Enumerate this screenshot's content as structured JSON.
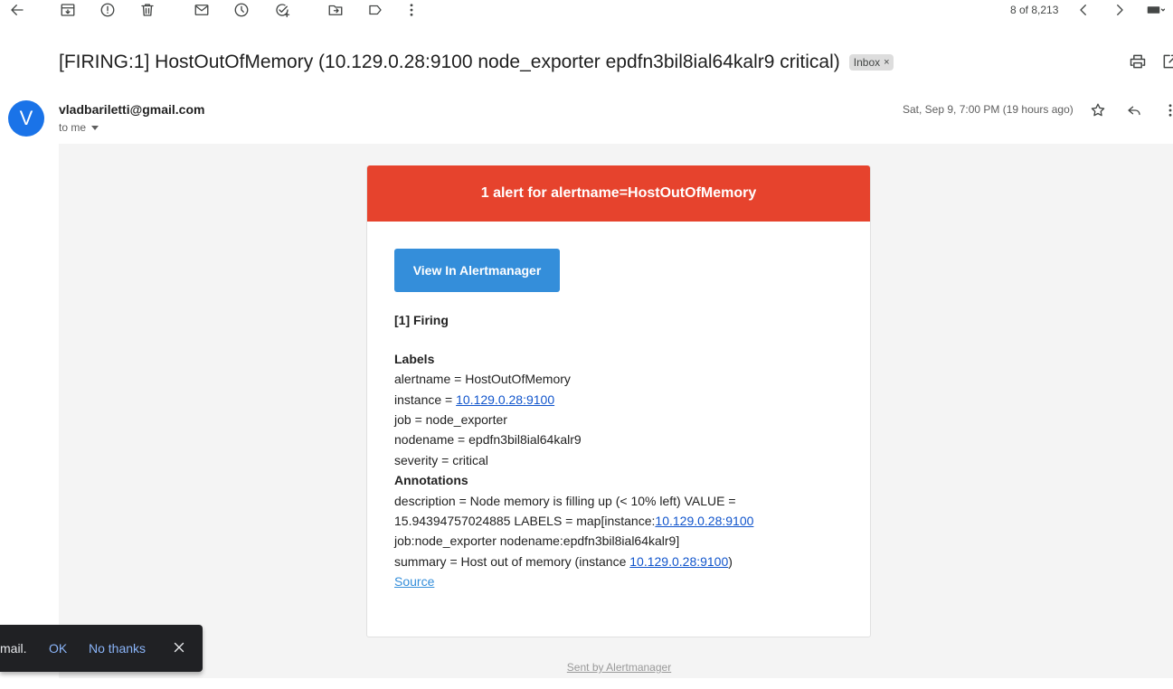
{
  "toolbar": {
    "icons": [
      "back-arrow-icon",
      "archive-icon",
      "report-spam-icon",
      "delete-icon",
      "mark-unread-icon",
      "snooze-icon",
      "add-to-tasks-icon",
      "move-to-icon",
      "label-icon",
      "more-vert-icon"
    ],
    "pager_count": "8 of 8,213"
  },
  "subject": "[FIRING:1] HostOutOfMemory (10.129.0.28:9100 node_exporter epdfn3bil8ial64kalr9 critical)",
  "inbox_chip": {
    "label": "Inbox",
    "remove": "×"
  },
  "message": {
    "avatar_letter": "V",
    "sender": "vladbariletti@gmail.com",
    "to": "to me",
    "date": "Sat, Sep 9, 7:00 PM (19 hours ago)"
  },
  "alert": {
    "header": "1 alert for alertname=HostOutOfMemory",
    "button": "View In Alertmanager",
    "firing": "[1] Firing",
    "labels_heading": "Labels",
    "alertname": "alertname = HostOutOfMemory",
    "instance_prefix": "instance = ",
    "instance_link": "10.129.0.28:9100",
    "job": "job = node_exporter",
    "nodename": "nodename = epdfn3bil8ial64kalr9",
    "severity": "severity = critical",
    "annotations_heading": "Annotations",
    "description_line1": "description = Node memory is filling up (< 10% left) VALUE =",
    "description_line2_prefix": "15.94394757024885 LABELS = map[instance:",
    "description_line2_link": "10.129.0.28:9100",
    "description_line3": "job:node_exporter nodename:epdfn3bil8ial64kalr9]",
    "summary_prefix": "summary = Host out of memory (instance ",
    "summary_link": "10.129.0.28:9100",
    "summary_suffix": ")",
    "source": "Source"
  },
  "footer": "Sent by Alertmanager",
  "toast": {
    "text": "mail.",
    "ok": "OK",
    "no_thanks": "No thanks"
  },
  "colors": {
    "alert_header": "#e6432d",
    "button": "#348eda",
    "link": "#1155cc",
    "avatar": "#1a73e8"
  }
}
